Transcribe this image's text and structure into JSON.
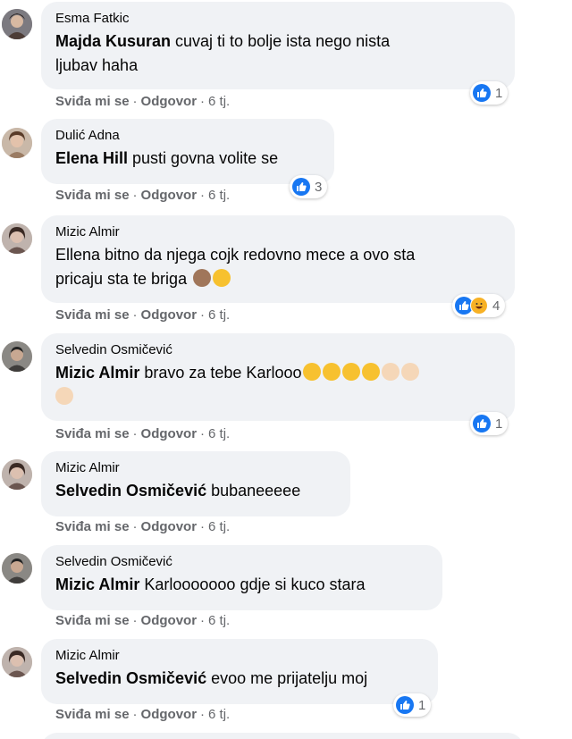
{
  "actions": {
    "like": "Sviđa mi se",
    "reply": "Odgovor",
    "sep": "·"
  },
  "comments": [
    {
      "author": "Esma Fatkic",
      "mention": "Majda Kusuran",
      "text_line1": " cuvaj ti to bolje ista nego nista",
      "text_line2": "ljubav haha",
      "time": "6 tj.",
      "reaction_count": "1"
    },
    {
      "author": "Dulić Adna",
      "mention": "Elena Hill",
      "text_line1": " pusti govna volite se",
      "time": "6 tj.",
      "reaction_count": "3"
    },
    {
      "author": "Mizic Almir",
      "text_line1": "Ellena bitno da njega cojk redovno mece a ovo sta",
      "text_line2": "pricaju sta te briga",
      "emojis": [
        "see-no-evil-monkey",
        "grinning-face"
      ],
      "time": "6 tj.",
      "reaction_count": "4"
    },
    {
      "author": "Selvedin Osmičević",
      "mention": "Mizic Almir",
      "text_line1": " bravo za tebe Karlooo",
      "emojis": [
        "tears-of-joy",
        "tears-of-joy",
        "tears-of-joy",
        "tears-of-joy",
        "clapping-hands",
        "clapping-hands",
        "clapping-hands"
      ],
      "time": "6 tj.",
      "reaction_count": "1"
    },
    {
      "author": "Mizic Almir",
      "mention": "Selvedin Osmičević",
      "text_line1": " bubaneeeee",
      "time": "6 tj."
    },
    {
      "author": "Selvedin Osmičević",
      "mention": "Mizic Almir",
      "text_line1": " Karlooooooo gdje si kuco stara",
      "time": "6 tj."
    },
    {
      "author": "Mizic Almir",
      "mention": "Selvedin Osmičević",
      "text_line1": " evoo me prijatelju moj",
      "time": "6 tj.",
      "reaction_count": "1"
    }
  ],
  "colors": {
    "bubble": "#f0f2f5",
    "like_blue": "#1877f2",
    "meta_gray": "#65676b",
    "haha_yellow": "#f7b125"
  }
}
